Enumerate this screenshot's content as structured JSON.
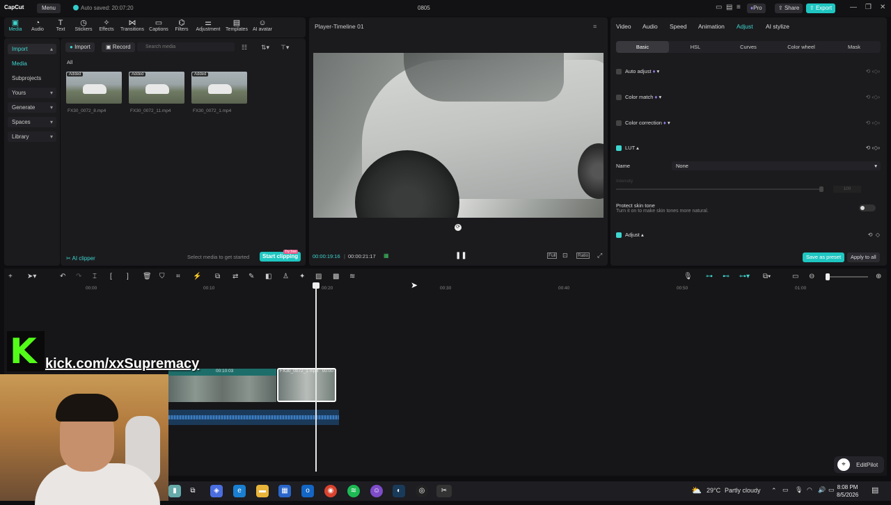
{
  "titlebar": {
    "app_logo": "CapCut",
    "menu_label": "Menu",
    "autosave": "Auto saved: 20:07:20",
    "project_name": "0805",
    "pro_label": "Pro",
    "share_label": "Share",
    "export_label": "Export"
  },
  "toolbar": {
    "items": [
      {
        "label": "Media",
        "icon": "media-icon"
      },
      {
        "label": "Audio",
        "icon": "audio-icon"
      },
      {
        "label": "Text",
        "icon": "text-icon"
      },
      {
        "label": "Stickers",
        "icon": "stickers-icon"
      },
      {
        "label": "Effects",
        "icon": "effects-icon"
      },
      {
        "label": "Transitions",
        "icon": "transitions-icon"
      },
      {
        "label": "Captions",
        "icon": "captions-icon"
      },
      {
        "label": "Filters",
        "icon": "filters-icon"
      },
      {
        "label": "Adjustment",
        "icon": "adjustment-icon"
      },
      {
        "label": "Templates",
        "icon": "templates-icon"
      },
      {
        "label": "AI avatar",
        "icon": "ai-avatar-icon"
      }
    ]
  },
  "sidebar": {
    "items": [
      {
        "label": "Import"
      },
      {
        "label": "Media"
      },
      {
        "label": "Subprojects"
      },
      {
        "label": "Yours"
      },
      {
        "label": "Generate"
      },
      {
        "label": "Spaces"
      },
      {
        "label": "Library"
      }
    ]
  },
  "media": {
    "import_label": "Import",
    "record_label": "Record",
    "search_placeholder": "Search media",
    "filter_all": "All",
    "clips": [
      {
        "name": "FX30_0072_8.mp4",
        "tag": "Added"
      },
      {
        "name": "FX30_0072_11.mp4",
        "tag": "Added"
      },
      {
        "name": "FX30_0072_1.mp4",
        "tag": "Added"
      }
    ],
    "ai_clipper": "AI clipper",
    "hint": "Select media to get started",
    "start_clipping": "Start clipping",
    "try_free": "Try free"
  },
  "player": {
    "title": "Player-Timeline 01",
    "current_time": "00:00:19:16",
    "total_time": "00:00:21:17",
    "full_label": "Full",
    "ratio_label": "Ratio"
  },
  "inspector": {
    "tabs": [
      "Video",
      "Audio",
      "Speed",
      "Animation",
      "Adjust",
      "AI stylize"
    ],
    "subtabs": [
      "Basic",
      "HSL",
      "Curves",
      "Color wheel",
      "Mask"
    ],
    "rows": {
      "auto_adjust": "Auto adjust",
      "color_match": "Color match",
      "color_correction": "Color correction",
      "lut": "LUT",
      "name_label": "Name",
      "name_value": "None",
      "intensity_label": "Intensity",
      "intensity_value": "100",
      "protect_skin": "Protect skin tone",
      "protect_skin_desc": "Turn it on to make skin tones more natural.",
      "adjust": "Adjust"
    },
    "save_preset": "Save as preset",
    "apply_all": "Apply to all"
  },
  "timeline": {
    "ruler": [
      "00:00",
      "00:10",
      "00:20",
      "00:30",
      "00:40",
      "00:50",
      "01:00"
    ],
    "clip1_time": "00:10:03",
    "clip2_label": "FX30_0072_1.mp4",
    "clip2_time": "00:00"
  },
  "overlay": {
    "kick_letter": "K",
    "kick_url": "kick.com/xxSupremacy",
    "editpilot": "EditPilot"
  },
  "taskbar": {
    "weather_temp": "29°C",
    "weather_desc": "Partly cloudy",
    "time": "8:08 PM",
    "date": "8/5/2026"
  },
  "colors": {
    "accent": "#3fd6cf",
    "kick_green": "#53fc18"
  }
}
